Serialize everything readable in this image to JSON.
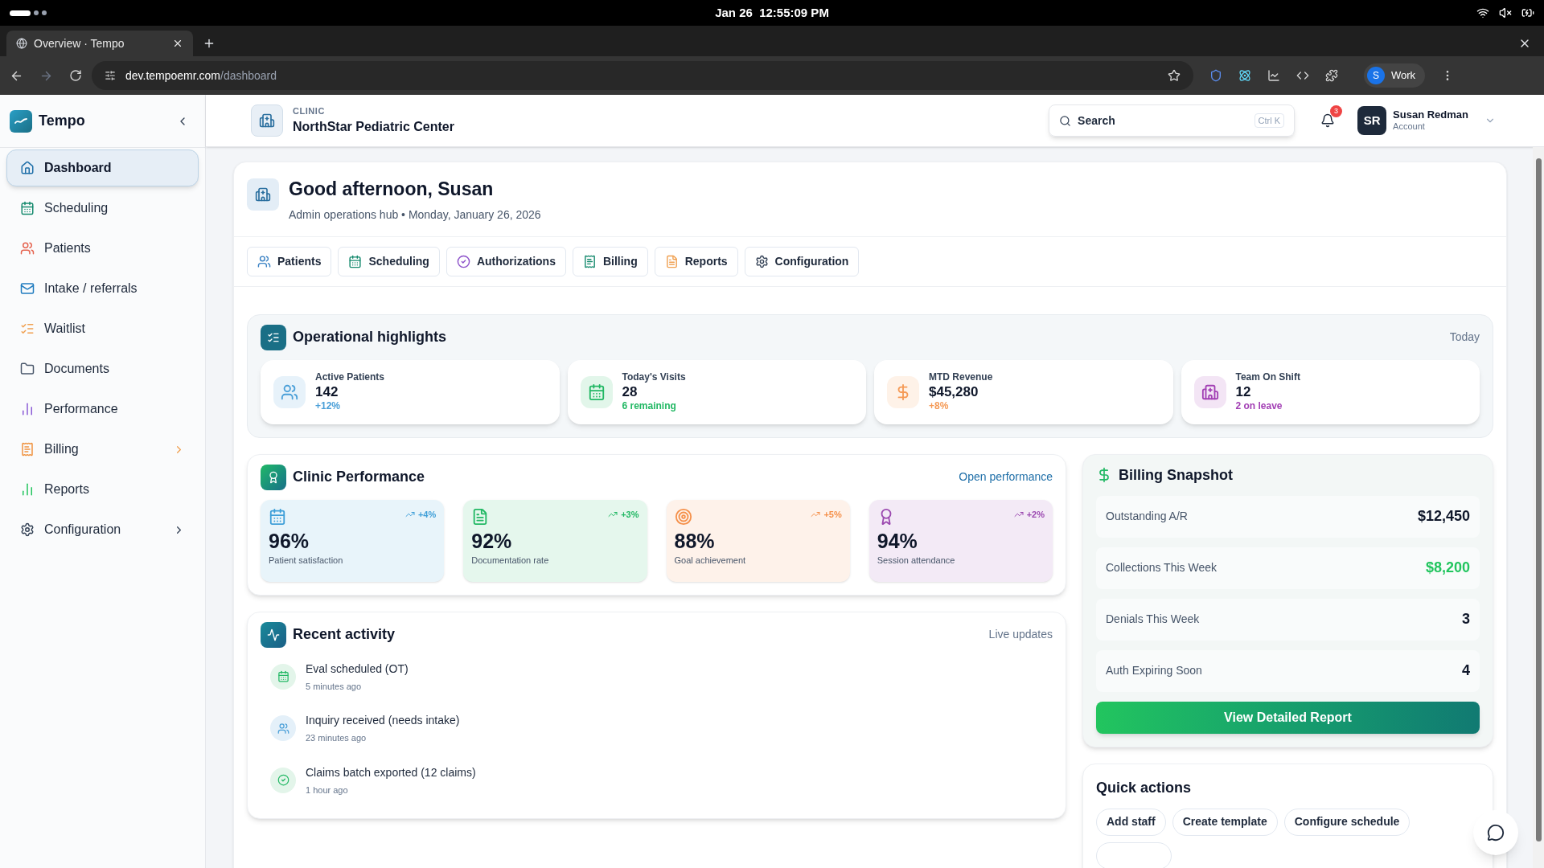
{
  "system_bar": {
    "clock": "Jan 26  12:55:09 PM"
  },
  "browser": {
    "tab_title": "Overview · Tempo",
    "url_host": "dev.tempoemr.com",
    "url_path": "/dashboard",
    "profile_initial": "S",
    "profile_name": "Work"
  },
  "sidebar": {
    "brand": "Tempo",
    "items": [
      {
        "label": "Dashboard",
        "selected": true,
        "has_submenu": false
      },
      {
        "label": "Scheduling",
        "selected": false,
        "has_submenu": false
      },
      {
        "label": "Patients",
        "selected": false,
        "has_submenu": false
      },
      {
        "label": "Intake / referrals",
        "selected": false,
        "has_submenu": false
      },
      {
        "label": "Waitlist",
        "selected": false,
        "has_submenu": false
      },
      {
        "label": "Documents",
        "selected": false,
        "has_submenu": false
      },
      {
        "label": "Performance",
        "selected": false,
        "has_submenu": false
      },
      {
        "label": "Billing",
        "selected": false,
        "has_submenu": true
      },
      {
        "label": "Reports",
        "selected": false,
        "has_submenu": false
      },
      {
        "label": "Configuration",
        "selected": false,
        "has_submenu": true
      }
    ]
  },
  "header": {
    "clinic_caption": "CLINIC",
    "clinic_name": "NorthStar Pediatric Center",
    "search": {
      "placeholder": "Search",
      "shortcut": "Ctrl K"
    },
    "notifications": "3",
    "user": {
      "initials": "SR",
      "name": "Susan Redman",
      "role": "Account"
    }
  },
  "greeting": {
    "title": "Good afternoon, Susan",
    "subtitle": "Admin operations hub • Monday, January 26, 2026"
  },
  "quick_tabs": [
    "Patients",
    "Scheduling",
    "Authorizations",
    "Billing",
    "Reports",
    "Configuration"
  ],
  "highlights": {
    "title": "Operational highlights",
    "period": "Today",
    "cards": [
      {
        "label": "Active Patients",
        "value": "142",
        "note": "+12%",
        "color": "#4a9fd8"
      },
      {
        "label": "Today's Visits",
        "value": "28",
        "note": "6 remaining",
        "color": "#22b864"
      },
      {
        "label": "MTD Revenue",
        "value": "$45,280",
        "note": "+8%",
        "color": "#f59a56"
      },
      {
        "label": "Team On Shift",
        "value": "12",
        "note": "2 on leave",
        "color": "#a23fb4"
      }
    ]
  },
  "performance": {
    "title": "Clinic Performance",
    "link": "Open performance",
    "cards": [
      {
        "value": "96%",
        "label": "Patient satisfaction",
        "change": "+4%",
        "color": "#3f9fd8"
      },
      {
        "value": "92%",
        "label": "Documentation rate",
        "change": "+3%",
        "color": "#22b864"
      },
      {
        "value": "88%",
        "label": "Goal achievement",
        "change": "+5%",
        "color": "#f5904a"
      },
      {
        "value": "94%",
        "label": "Session attendance",
        "change": "+2%",
        "color": "#9b49b0"
      }
    ]
  },
  "activity": {
    "title": "Recent activity",
    "status": "Live updates",
    "items": [
      {
        "title": "Eval scheduled (OT)",
        "time": "5 minutes ago"
      },
      {
        "title": "Inquiry received (needs intake)",
        "time": "23 minutes ago"
      },
      {
        "title": "Claims batch exported (12 claims)",
        "time": "1 hour ago"
      }
    ]
  },
  "billing": {
    "title": "Billing Snapshot",
    "rows": [
      {
        "label": "Outstanding A/R",
        "value": "$12,450",
        "positive": false
      },
      {
        "label": "Collections This Week",
        "value": "$8,200",
        "positive": true
      },
      {
        "label": "Denials This Week",
        "value": "3",
        "positive": false
      },
      {
        "label": "Auth Expiring Soon",
        "value": "4",
        "positive": false
      }
    ],
    "button": "View Detailed Report"
  },
  "quick_actions": {
    "title": "Quick actions",
    "buttons": [
      "Add staff",
      "Create template",
      "Configure schedule"
    ]
  }
}
